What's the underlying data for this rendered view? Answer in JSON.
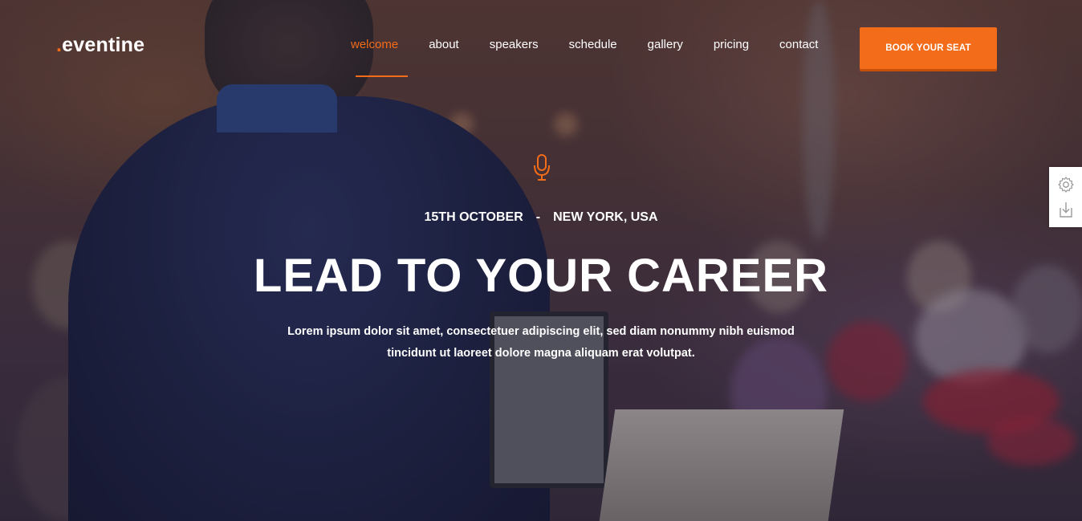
{
  "brand": {
    "dot": ".",
    "name": "eventine",
    "accent_color": "#f26c1a"
  },
  "nav": {
    "items": [
      {
        "label": "welcome",
        "active": true
      },
      {
        "label": "about",
        "active": false
      },
      {
        "label": "speakers",
        "active": false
      },
      {
        "label": "schedule",
        "active": false
      },
      {
        "label": "gallery",
        "active": false
      },
      {
        "label": "pricing",
        "active": false
      },
      {
        "label": "contact",
        "active": false
      }
    ],
    "cta_label": "BOOK YOUR SEAT"
  },
  "hero": {
    "icon": "microphone-icon",
    "date": "15TH OCTOBER",
    "separator": "-",
    "location": "NEW YORK, USA",
    "title": "LEAD TO YOUR CAREER",
    "description_line1": "Lorem ipsum dolor sit amet, consectetuer adipiscing elit, sed diam nonummy nibh euismod",
    "description_line2": "tincidunt ut laoreet dolore magna aliquam erat volutpat."
  },
  "side_panel": {
    "icons": [
      "gear-icon",
      "download-icon"
    ]
  }
}
